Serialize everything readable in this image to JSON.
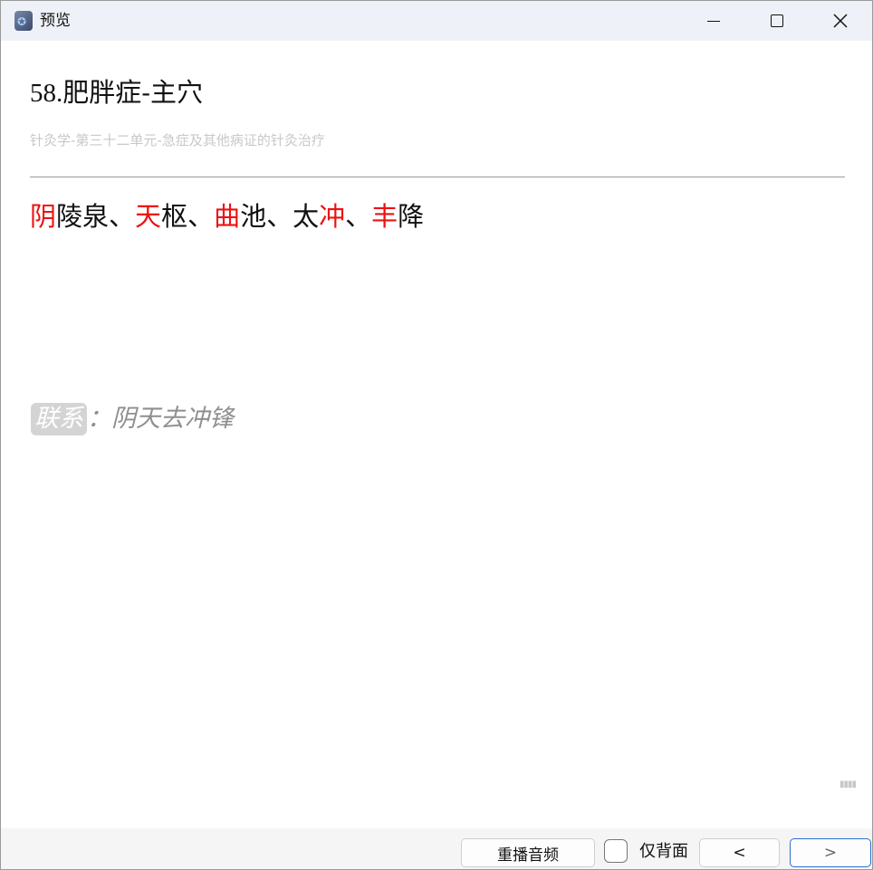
{
  "window": {
    "title": "预览",
    "controls": {
      "minimize": "minimize-icon",
      "maximize": "maximize-icon",
      "close": "close-icon"
    }
  },
  "card": {
    "title_number": "58.",
    "title_text": "肥胖症-主穴",
    "subtitle": "针灸学-第三十二单元-急症及其他病证的针灸治疗",
    "answer_parts": [
      {
        "text": "阴",
        "highlight": true
      },
      {
        "text": "陵泉、",
        "highlight": false
      },
      {
        "text": "天",
        "highlight": true
      },
      {
        "text": "枢、",
        "highlight": false
      },
      {
        "text": "曲",
        "highlight": true
      },
      {
        "text": "池、太",
        "highlight": false
      },
      {
        "text": "冲",
        "highlight": true
      },
      {
        "text": "、",
        "highlight": false
      },
      {
        "text": "丰",
        "highlight": true
      },
      {
        "text": "降",
        "highlight": false
      }
    ],
    "relation_label": "联系",
    "relation_sep": "：",
    "relation_text": "阴天去冲锋",
    "highlight_color": "#ee1111"
  },
  "toolbar": {
    "replay_audio": "重播音频",
    "back_only_label": "仅背面",
    "back_only_checked": false,
    "prev": "<",
    "next": ">"
  }
}
